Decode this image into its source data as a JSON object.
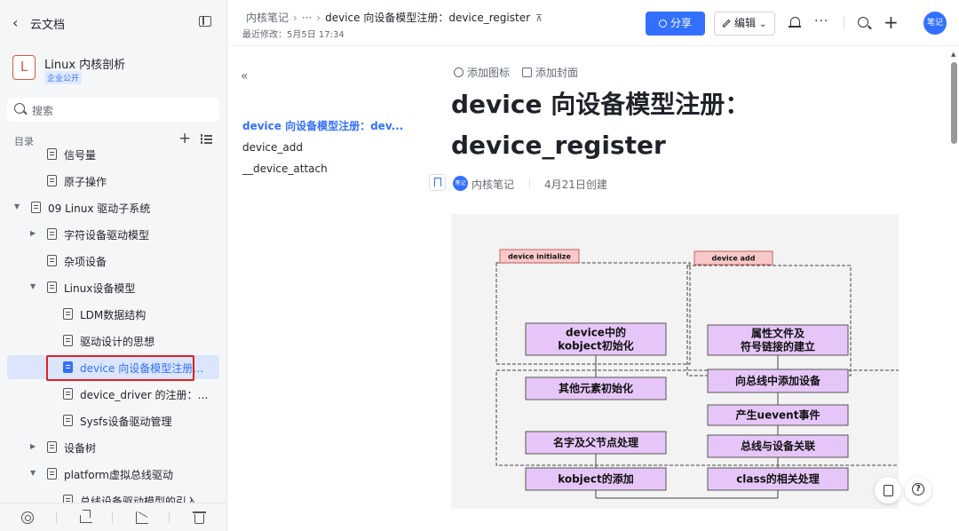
{
  "sidebar": {
    "back_label": "云文档",
    "space": {
      "avatar_letter": "L",
      "name": "Linux 内核剖析",
      "badge": "企业公开"
    },
    "search_label": "搜索",
    "toc_title": "目录",
    "tree": [
      {
        "label": "信号量",
        "level": 2,
        "arrow": "",
        "active": false
      },
      {
        "label": "原子操作",
        "level": 2,
        "arrow": "",
        "active": false
      },
      {
        "label": "09 Linux 驱动子系统",
        "level": 1,
        "arrow": "▼",
        "active": false
      },
      {
        "label": "字符设备驱动模型",
        "level": 2,
        "arrow": "▶",
        "active": false
      },
      {
        "label": "杂项设备",
        "level": 2,
        "arrow": "",
        "active": false
      },
      {
        "label": "Linux设备模型",
        "level": 2,
        "arrow": "▼",
        "active": false
      },
      {
        "label": "LDM数据结构",
        "level": 3,
        "arrow": "",
        "active": false
      },
      {
        "label": "驱动设计的思想",
        "level": 3,
        "arrow": "",
        "active": false
      },
      {
        "label": "device 向设备模型注册：device_register",
        "level": 3,
        "arrow": "",
        "active": true
      },
      {
        "label": "device_driver 的注册：driver_register",
        "level": 3,
        "arrow": "",
        "active": false
      },
      {
        "label": "Sysfs设备驱动管理",
        "level": 3,
        "arrow": "",
        "active": false
      },
      {
        "label": "设备树",
        "level": 2,
        "arrow": "▶",
        "active": false
      },
      {
        "label": "platform虚拟总线驱动",
        "level": 2,
        "arrow": "▼",
        "active": false
      },
      {
        "label": "总线设备驱动模型的引入",
        "level": 3,
        "arrow": "",
        "active": false
      }
    ]
  },
  "header": {
    "breadcrumbs": [
      "内核笔记",
      "···",
      "device 向设备模型注册：device_register"
    ],
    "modified": "最近修改：5月5日 17:34",
    "share_label": "分享",
    "edit_label": "编辑",
    "avatar_text": "笔记"
  },
  "doc": {
    "add_icon": "添加图标",
    "add_cover": "添加封面",
    "title": "device 向设备模型注册：device_register",
    "author_avatar": "笔记",
    "author": "内核笔记",
    "created": "4月21日创建",
    "outline": [
      {
        "label": "device 向设备模型注册：dev...",
        "active": true
      },
      {
        "label": "device_add",
        "active": false
      },
      {
        "label": "__device_attach",
        "active": false
      }
    ]
  },
  "diagram": {
    "tag_left": "device initialize",
    "tag_right": "device add",
    "left_boxes": [
      "device中的\nkobject初始化",
      "其他元素初始化",
      "名字及父节点处理",
      "kobject的添加"
    ],
    "right_boxes": [
      "属性文件及\n符号链接的建立",
      "向总线中添加设备",
      "产生uevent事件",
      "总线与设备关联",
      "class的相关处理"
    ],
    "box_fill": "#e6c6f8",
    "tag_fill": "#f9c9c9"
  },
  "colors": {
    "accent": "#3370ff",
    "highlight_outline": "#e02020"
  }
}
